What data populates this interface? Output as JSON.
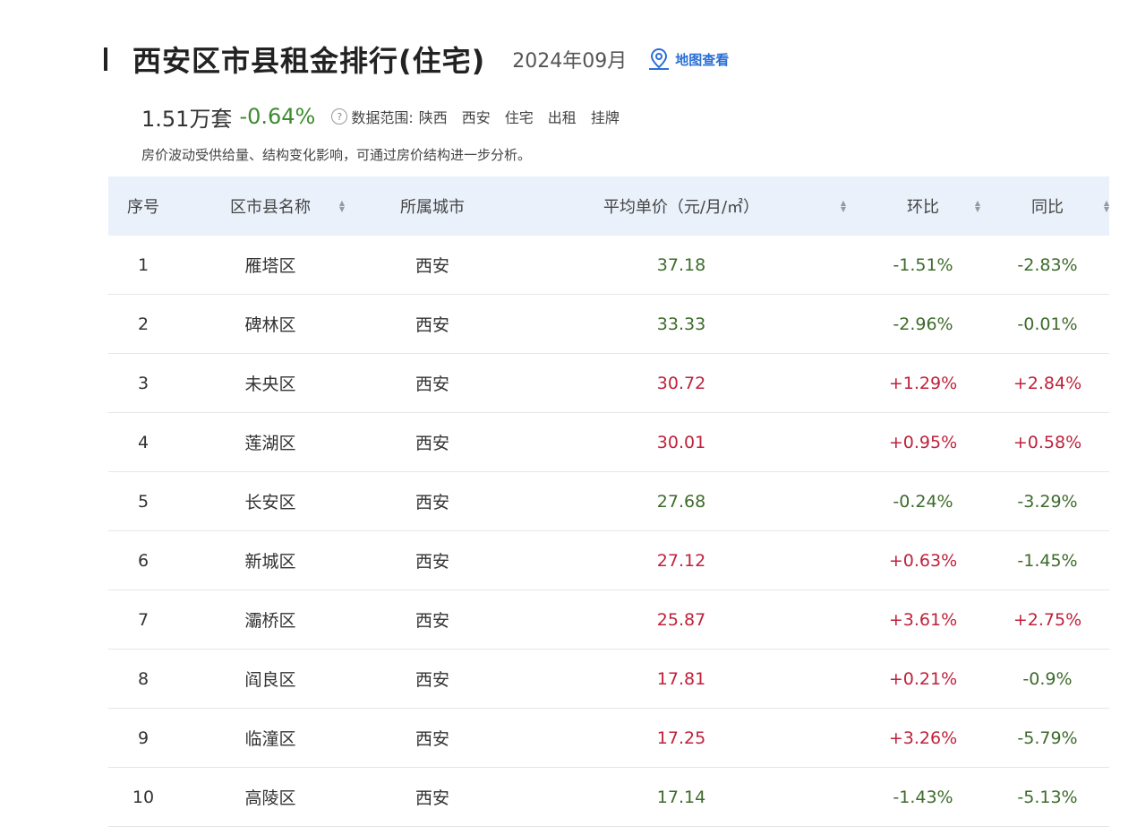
{
  "header": {
    "title": "西安区市县租金排行(住宅)",
    "date": "2024年09月",
    "map_link_label": "地图查看"
  },
  "summary": {
    "count": "1.51万套",
    "change": "-0.64%",
    "scope_label": "数据范围:",
    "scope_items": [
      "陕西",
      "西安",
      "住宅",
      "出租",
      "挂牌"
    ]
  },
  "note": "房价波动受供给量、结构变化影响，可通过房价结构进一步分析。",
  "table": {
    "columns": [
      "序号",
      "区市县名称",
      "所属城市",
      "平均单价（元/月/㎡）",
      "环比",
      "同比"
    ],
    "rows": [
      {
        "rank": "1",
        "district": "雁塔区",
        "city": "西安",
        "price": "37.18",
        "mom": "-1.51%",
        "yoy": "-2.83%"
      },
      {
        "rank": "2",
        "district": "碑林区",
        "city": "西安",
        "price": "33.33",
        "mom": "-2.96%",
        "yoy": "-0.01%"
      },
      {
        "rank": "3",
        "district": "未央区",
        "city": "西安",
        "price": "30.72",
        "mom": "+1.29%",
        "yoy": "+2.84%"
      },
      {
        "rank": "4",
        "district": "莲湖区",
        "city": "西安",
        "price": "30.01",
        "mom": "+0.95%",
        "yoy": "+0.58%"
      },
      {
        "rank": "5",
        "district": "长安区",
        "city": "西安",
        "price": "27.68",
        "mom": "-0.24%",
        "yoy": "-3.29%"
      },
      {
        "rank": "6",
        "district": "新城区",
        "city": "西安",
        "price": "27.12",
        "mom": "+0.63%",
        "yoy": "-1.45%"
      },
      {
        "rank": "7",
        "district": "灞桥区",
        "city": "西安",
        "price": "25.87",
        "mom": "+3.61%",
        "yoy": "+2.75%"
      },
      {
        "rank": "8",
        "district": "阎良区",
        "city": "西安",
        "price": "17.81",
        "mom": "+0.21%",
        "yoy": "-0.9%"
      },
      {
        "rank": "9",
        "district": "临潼区",
        "city": "西安",
        "price": "17.25",
        "mom": "+3.26%",
        "yoy": "-5.79%"
      },
      {
        "rank": "10",
        "district": "高陵区",
        "city": "西安",
        "price": "17.14",
        "mom": "-1.43%",
        "yoy": "-5.13%"
      }
    ]
  },
  "colors": {
    "up": "#c0213b",
    "down": "#3d6b2a",
    "header_bg": "#eaf1fb",
    "link": "#2a6fd6"
  },
  "icons": {
    "map": "map-pin-icon",
    "help": "help-icon",
    "sort": "sort-icon"
  }
}
